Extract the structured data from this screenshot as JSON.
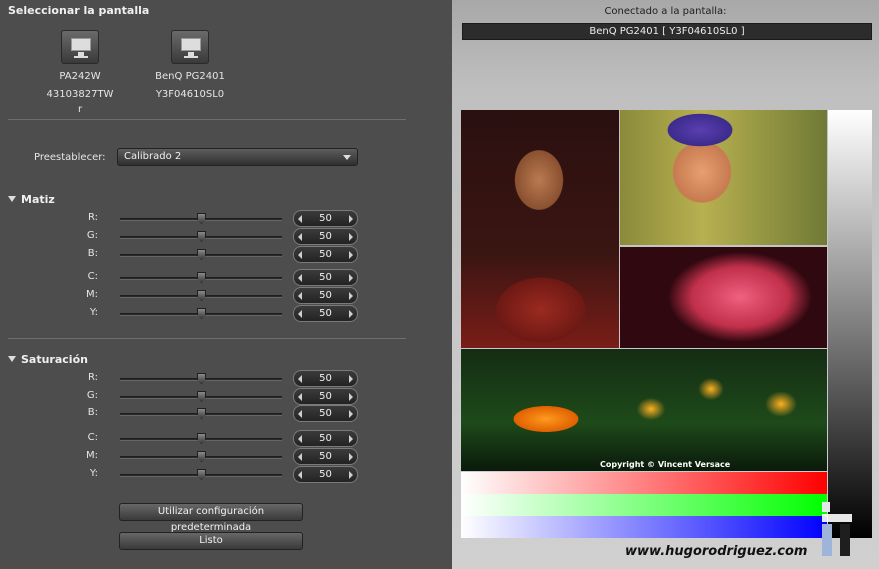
{
  "left": {
    "select_screen_title": "Seleccionar la pantalla",
    "monitors": [
      {
        "name": "PA242W",
        "serial_line1": "43103827TW",
        "serial_line2": "r"
      },
      {
        "name": "BenQ PG2401",
        "serial_line1": "Y3F04610SL0",
        "serial_line2": ""
      }
    ],
    "preset_label": "Preestablecer:",
    "preset_value": "Calibrado 2",
    "hue": {
      "title": "Matiz",
      "rows": [
        {
          "label": "R:",
          "value": "50",
          "level": 0.5
        },
        {
          "label": "G:",
          "value": "50",
          "level": 0.5
        },
        {
          "label": "B:",
          "value": "50",
          "level": 0.5
        },
        {
          "label": "C:",
          "value": "50",
          "level": 0.5
        },
        {
          "label": "M:",
          "value": "50",
          "level": 0.5
        },
        {
          "label": "Y:",
          "value": "50",
          "level": 0.5
        }
      ]
    },
    "saturation": {
      "title": "Saturación",
      "rows": [
        {
          "label": "R:",
          "value": "50",
          "level": 0.5
        },
        {
          "label": "G:",
          "value": "50",
          "level": 0.5
        },
        {
          "label": "B:",
          "value": "50",
          "level": 0.5
        },
        {
          "label": "C:",
          "value": "50",
          "level": 0.5
        },
        {
          "label": "M:",
          "value": "50",
          "level": 0.5
        },
        {
          "label": "Y:",
          "value": "50",
          "level": 0.5
        }
      ]
    },
    "default_button": "Utilizar configuración predeterminada",
    "done_button": "Listo"
  },
  "right": {
    "connected_label": "Conectado a la pantalla:",
    "connected_value": "BenQ PG2401 [ Y3F04610SL0 ]",
    "copyright": "Copyright © Vincent Versace",
    "watermark": "www.hugorodriguez.com"
  },
  "colors": {
    "panel_bg": "#4d4d4d",
    "preview_bg": "#c4c4c4",
    "text": "#e8e8e8"
  }
}
